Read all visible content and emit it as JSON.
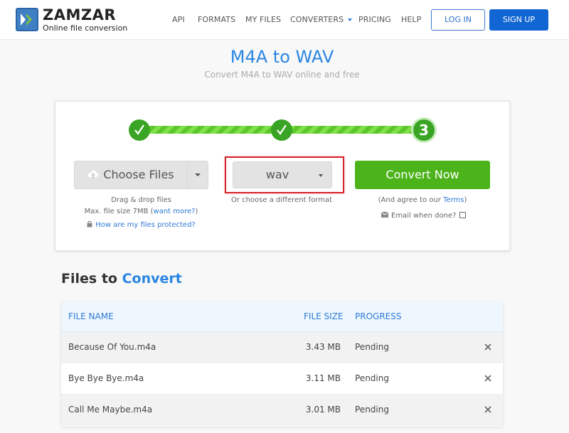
{
  "header": {
    "logo": {
      "name": "ZAMZAR",
      "trademark": "™",
      "tagline": "Online file conversion"
    },
    "nav": [
      {
        "label": "API"
      },
      {
        "label": "FORMATS"
      },
      {
        "label": "MY FILES"
      },
      {
        "label": "CONVERTERS",
        "has_dropdown": true
      },
      {
        "label": "PRICING"
      },
      {
        "label": "HELP"
      }
    ],
    "login_label": "LOG IN",
    "signup_label": "SIGN UP"
  },
  "page": {
    "title": "M4A to WAV",
    "subtitle": "Convert M4A to WAV online and free"
  },
  "converter": {
    "steps": [
      {
        "state": "done",
        "icon": "check-icon"
      },
      {
        "state": "done",
        "icon": "check-icon"
      },
      {
        "state": "current",
        "label": "3"
      }
    ],
    "choose_files": {
      "label": "Choose Files",
      "drag_text": "Drag & drop files",
      "max_size_text": "Max. file size 7MB (",
      "want_more_link": "want more?",
      "max_size_close": ")",
      "protected_link": "How are my files protected?"
    },
    "format": {
      "selected": "wav",
      "hint": "Or choose a different format"
    },
    "convert": {
      "label": "Convert Now",
      "agree_prefix": "(And agree to our ",
      "terms_link": "Terms",
      "agree_suffix": ")",
      "email_label": "Email when done?",
      "email_checked": false
    }
  },
  "files": {
    "title_prefix": "Files to",
    "title_accent": "Convert",
    "columns": {
      "name": "FILE NAME",
      "size": "FILE SIZE",
      "progress": "PROGRESS"
    },
    "rows": [
      {
        "name": "Because Of You.m4a",
        "size": "3.43 MB",
        "progress": "Pending"
      },
      {
        "name": "Bye Bye Bye.m4a",
        "size": "3.11 MB",
        "progress": "Pending"
      },
      {
        "name": "Call Me Maybe.m4a",
        "size": "3.01 MB",
        "progress": "Pending"
      }
    ]
  },
  "colors": {
    "brand_blue": "#2a86e3",
    "signup_blue": "#1266d4",
    "convert_green": "#4cb31a",
    "step_green": "#3aa524",
    "highlight_red": "#d7232b"
  }
}
